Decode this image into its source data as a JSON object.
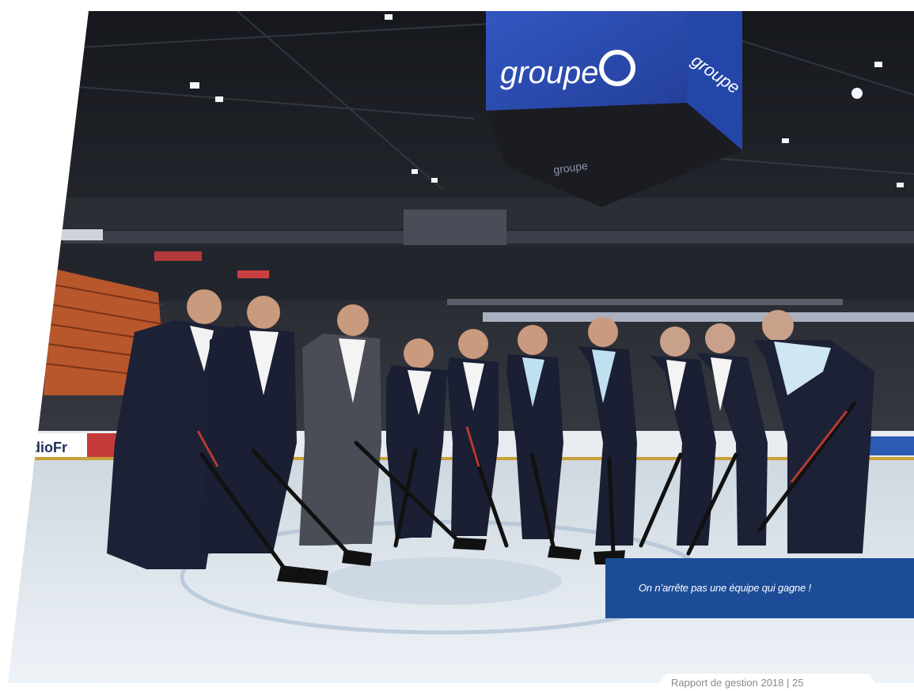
{
  "scoreboard": {
    "brand_front": "groupe",
    "brand_side": "groupe",
    "brand_bottom": "groupe"
  },
  "banners": {
    "left_fragment": "dioFr"
  },
  "caption": {
    "text": "On n’arrête pas une équipe qui gagne !"
  },
  "footer": {
    "text": "Rapport de gestion 2018  |  25"
  },
  "colors": {
    "brand_blue": "#1d4c97",
    "scoreboard_blue": "#2b4fb8",
    "ice": "#e4ecf3"
  }
}
